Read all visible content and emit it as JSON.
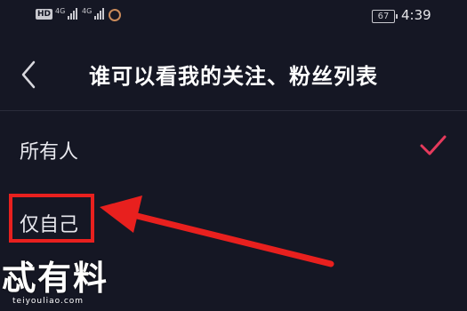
{
  "status_bar": {
    "hd_label": "HD",
    "network_1": "4G",
    "network_2": "4G",
    "battery": "67",
    "time": "4:39"
  },
  "header": {
    "title": "谁可以看我的关注、粉丝列表",
    "back_icon": "chevron-left-icon"
  },
  "options": [
    {
      "label": "所有人",
      "selected": true
    },
    {
      "label": "仅自己",
      "selected": false
    }
  ],
  "annotation": {
    "color": "#e8201e"
  },
  "watermark": {
    "text": "忒有料",
    "url": "teiyouliao.com"
  },
  "colors": {
    "background": "#151724",
    "accent_check": "#e63a5c",
    "annotation_red": "#e8201e"
  }
}
